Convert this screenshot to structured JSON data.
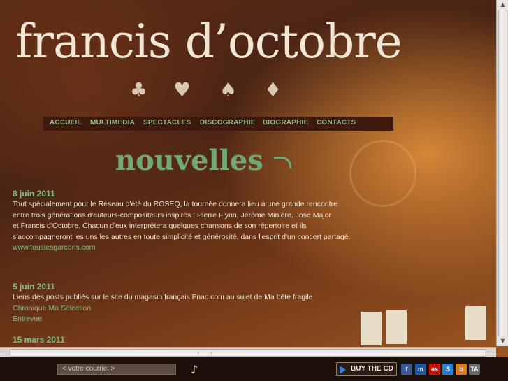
{
  "site": {
    "logo_text": "francis d’octobre",
    "suits": [
      "♣",
      "♥",
      "♠",
      "♦"
    ]
  },
  "nav": {
    "items": [
      {
        "label": "ACCUEIL"
      },
      {
        "label": "MULTIMEDIA"
      },
      {
        "label": "SPECTACLES"
      },
      {
        "label": "DISCOGRAPHIE"
      },
      {
        "label": "BIOGRAPHIE"
      },
      {
        "label": "CONTACTS"
      }
    ]
  },
  "page": {
    "title": "nouvelles"
  },
  "news": [
    {
      "date": "8 juin 2011",
      "lines": [
        "Tout spécialement pour le Réseau d'été du ROSEQ, la tournée donnera lieu à une grande rencontre",
        "entre trois générations d'auteurs-compositeurs inspirés : Pierre Flynn, Jérôme Minière, José Major",
        "et Francis d'Octobre. Chacun d'eux interprètera quelques chansons de son répertoire et ils",
        "s'accompagneront les uns les autres en toute simplicité et générosité, dans l'esprit d'un concert partagé."
      ],
      "links": [
        "www.touslesgarcons.com"
      ]
    },
    {
      "date": "5 juin 2011",
      "lines": [
        "Liens des posts publiés sur le site du magasin français Fnac.com au sujet de Ma bête fragile"
      ],
      "links": [
        "Chronique Ma Sélection",
        "Entrevue"
      ]
    },
    {
      "date": "15 mars 2011",
      "lines": [],
      "links": []
    }
  ],
  "footer": {
    "email_placeholder": "< votre courriel >",
    "buy_cd_label": "BUY THE CD",
    "social": [
      {
        "icon": "facebook-icon",
        "glyph": "f",
        "color": "#3b5998"
      },
      {
        "icon": "myspace-icon",
        "glyph": "m",
        "color": "#1d5aa8"
      },
      {
        "icon": "lastfm-icon",
        "glyph": "as",
        "color": "#d51007"
      },
      {
        "icon": "skype-icon",
        "glyph": "S",
        "color": "#2a7fd4"
      },
      {
        "icon": "blog-icon",
        "glyph": "b",
        "color": "#e07b1c"
      },
      {
        "icon": "ta-icon",
        "glyph": "TA",
        "color": "#6b6b6b"
      }
    ]
  },
  "colors": {
    "accent_green": "#7fbf86",
    "text_cream": "#f2e6d6",
    "nav_bg": "#3d1a0d"
  }
}
